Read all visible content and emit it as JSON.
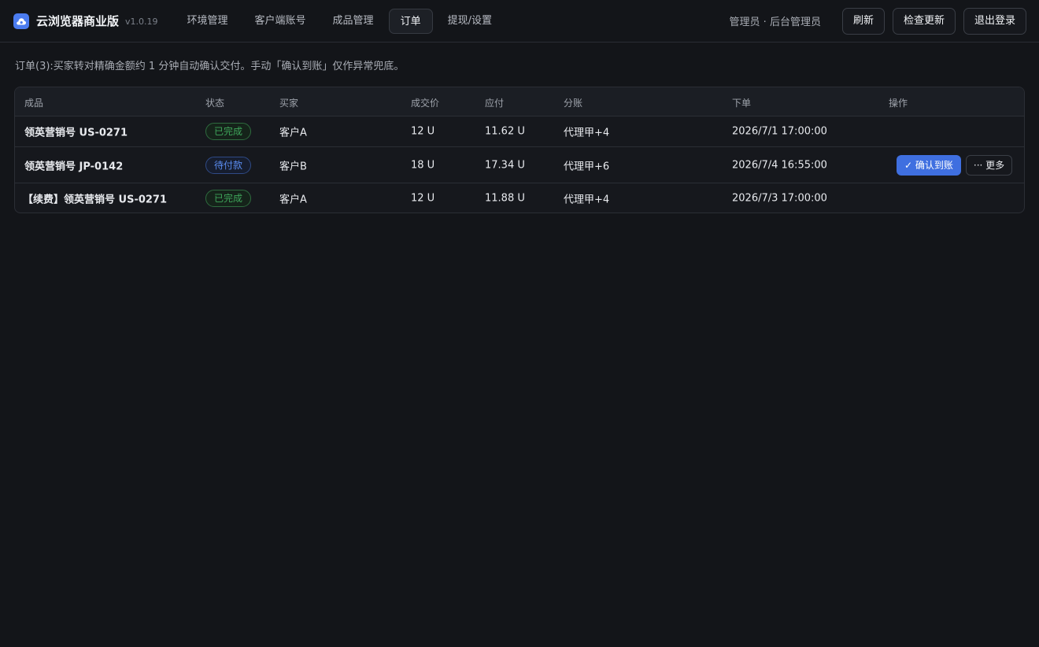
{
  "app": {
    "title": "云浏览器商业版",
    "version": "v1.0.19",
    "brand_color": "#4b7cf0"
  },
  "nav": {
    "items": [
      {
        "label": "环境管理",
        "active": false
      },
      {
        "label": "客户端账号",
        "active": false
      },
      {
        "label": "成品管理",
        "active": false
      },
      {
        "label": "订单",
        "active": true
      },
      {
        "label": "提现/设置",
        "active": false
      }
    ]
  },
  "header": {
    "user": "管理员 · 后台管理员",
    "refresh_label": "刷新",
    "check_update_label": "检查更新",
    "logout_label": "退出登录"
  },
  "notice": "订单(3):买家转对精确金额约 1 分钟自动确认交付。手动「确认到账」仅作异常兜底。",
  "table": {
    "headers": {
      "product": "成品",
      "status": "状态",
      "buyer": "买家",
      "price": "成交价",
      "payable": "应付",
      "split": "分账",
      "ordered": "下单",
      "actions": "操作"
    },
    "rows": [
      {
        "product": "领英营销号 US-0271",
        "status": "已完成",
        "status_type": "done",
        "buyer": "客户A",
        "price": "12 U",
        "payable": "11.62 U",
        "split": "代理甲+4",
        "ordered": "2026/7/1 17:00:00",
        "has_actions": false
      },
      {
        "product": "领英营销号 JP-0142",
        "status": "待付款",
        "status_type": "pending",
        "buyer": "客户B",
        "price": "18 U",
        "payable": "17.34 U",
        "split": "代理甲+6",
        "ordered": "2026/7/4 16:55:00",
        "has_actions": true,
        "confirm_label": "✓ 确认到账",
        "more_label": "··· 更多"
      },
      {
        "product": "【续费】领英营销号 US-0271",
        "status": "已完成",
        "status_type": "done",
        "buyer": "客户A",
        "price": "12 U",
        "payable": "11.88 U",
        "split": "代理甲+4",
        "ordered": "2026/7/3 17:00:00",
        "has_actions": false
      }
    ]
  },
  "colors": {
    "done": "#3fa55b",
    "pending": "#5a8cf0",
    "confirm_button": "#3f6fe0"
  },
  "icons": {
    "logo": "cloud-icon"
  }
}
